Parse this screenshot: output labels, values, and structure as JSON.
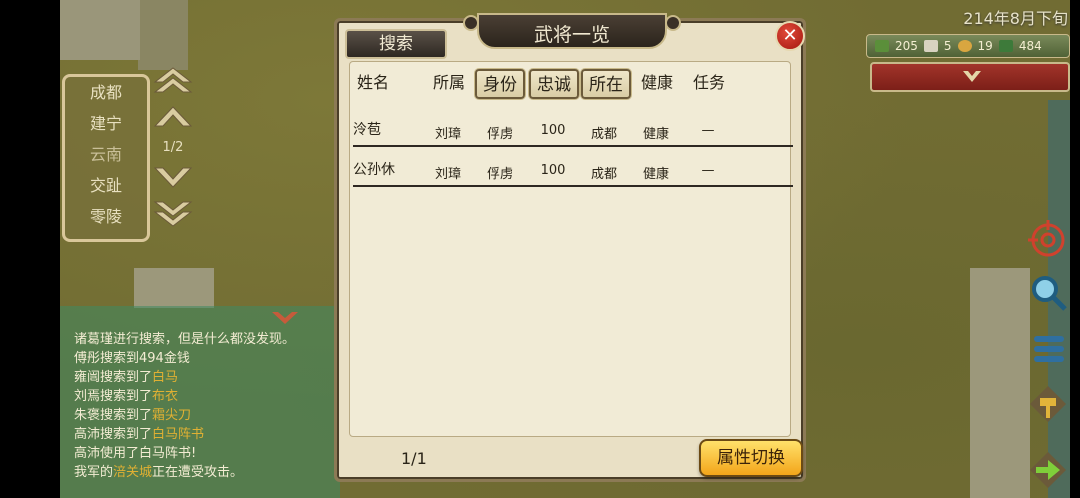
{
  "dialog": {
    "title": "武将一览",
    "search_label": "搜索",
    "close_symbol": "✕",
    "headers": [
      "姓名",
      "所属",
      "身份",
      "忠诚",
      "所在",
      "健康",
      "任务"
    ],
    "rows": [
      {
        "name": "泠苞",
        "faction": "刘璋",
        "status": "俘虏",
        "loyalty": "100",
        "location": "成都",
        "health": "健康",
        "task": "—"
      },
      {
        "name": "公孙休",
        "faction": "刘璋",
        "status": "俘虏",
        "loyalty": "100",
        "location": "成都",
        "health": "健康",
        "task": "—"
      }
    ],
    "page": "1/1",
    "switch_label": "属性切换"
  },
  "cities": {
    "items": [
      "成都",
      "建宁",
      "云南",
      "交趾",
      "零陵"
    ],
    "page": "1/2"
  },
  "log": {
    "lines": [
      {
        "text": "诸葛瑾进行搜索，但是什么都没发现。"
      },
      {
        "text": "傅彤搜索到494金钱"
      },
      {
        "prefix": "雍闿搜索到了",
        "item": "白马"
      },
      {
        "prefix": "刘焉搜索到了",
        "item": "布衣"
      },
      {
        "prefix": "朱褒搜索到了",
        "item": "霜尖刀"
      },
      {
        "prefix": "高沛搜索到了",
        "item": "白马阵书"
      },
      {
        "text": "高沛使用了白马阵书!"
      },
      {
        "prefix": "我军的",
        "item": "涪关城",
        "suffix": "正在遭受攻击。"
      }
    ]
  },
  "date": "214年8月下旬",
  "resources": {
    "troops": "205",
    "items": "5",
    "generals": "19",
    "gold": "484"
  },
  "colors": {
    "accent_gold": "#f3a51a",
    "close_red": "#c0251a",
    "log_highlight": "#e0b033"
  }
}
